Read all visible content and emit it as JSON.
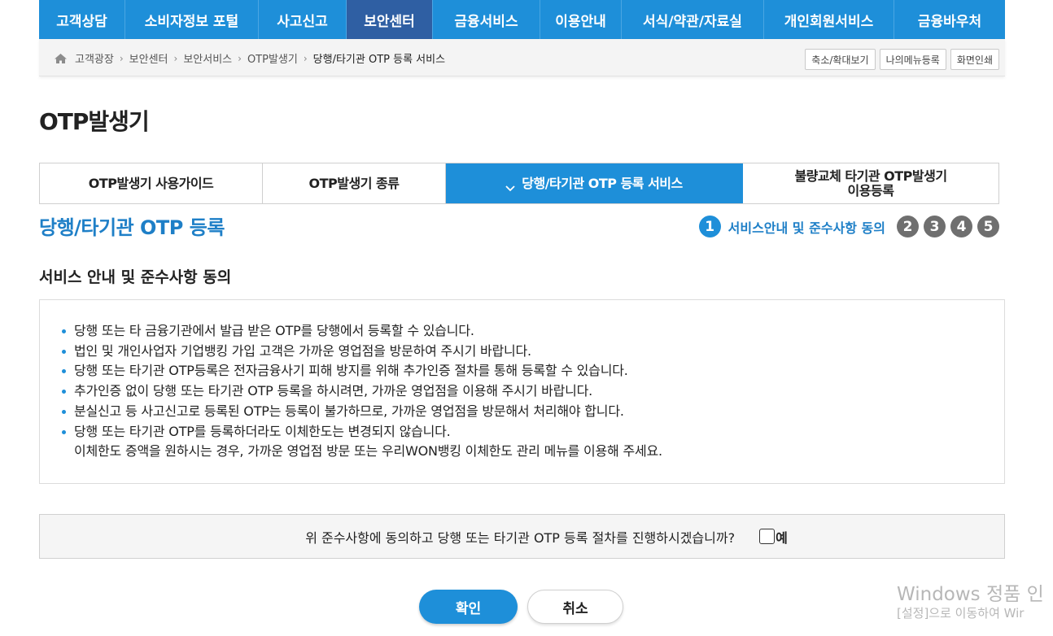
{
  "gnb": [
    {
      "label": "고객상담"
    },
    {
      "label": "소비자정보 포털"
    },
    {
      "label": "사고신고"
    },
    {
      "label": "보안센터",
      "active": true
    },
    {
      "label": "금융서비스"
    },
    {
      "label": "이용안내"
    },
    {
      "label": "서식/약관/자료실"
    },
    {
      "label": "개인회원서비스"
    },
    {
      "label": "금융바우처"
    }
  ],
  "breadcrumb": {
    "items": [
      "고객광장",
      "보안센터",
      "보안서비스",
      "OTP발생기",
      "당행/타기관 OTP 등록 서비스"
    ],
    "buttons": [
      "축소/확대보기",
      "나의메뉴등록",
      "화면인쇄"
    ]
  },
  "page_title": "OTP발생기",
  "tabs": [
    {
      "label": "OTP발생기 사용가이드"
    },
    {
      "label": "OTP발생기 종류"
    },
    {
      "label": "당행/타기관 OTP 등록 서비스",
      "active": true
    },
    {
      "label_line1": "불량교체 타기관 OTP발생기",
      "label_line2": "이용등록"
    }
  ],
  "section": {
    "title": "당행/타기관 OTP 등록",
    "current_step": "1",
    "current_step_label": "서비스안내 및 준수사항 동의",
    "other_steps": [
      "2",
      "3",
      "4",
      "5"
    ]
  },
  "sub_heading": "서비스 안내 및 준수사항 동의",
  "notice": [
    "당행 또는 타 금융기관에서 발급 받은 OTP를 당행에서 등록할 수 있습니다.",
    "법인 및 개인사업자 기업뱅킹 가입 고객은 가까운 영업점을 방문하여 주시기 바랍니다.",
    "당행 또는 타기관 OTP등록은 전자금융사기 피해 방지를 위해 추가인증 절차를 통해 등록할 수 있습니다.",
    "추가인증 없이 당행 또는 타기관 OTP 등록을 하시려면, 가까운 영업점을 이용해 주시기 바랍니다.",
    "분실신고 등 사고신고로 등록된 OTP는 등록이 불가하므로, 가까운 영업점을 방문해서 처리해야 합니다.",
    "당행 또는 타기관 OTP를 등록하더라도 이체한도는 변경되지 않습니다."
  ],
  "notice_continuation": "이체한도 증액을 원하시는 경우, 가까운 영업점 방문 또는 우리WON뱅킹 이체한도 관리 메뉴를 이용해 주세요.",
  "agree": {
    "question": "위 준수사항에 동의하고 당행 또는 타기관 OTP 등록 절차를 진행하시겠습니까?",
    "checkbox_label": "예",
    "checked": false
  },
  "buttons": {
    "confirm": "확인",
    "cancel": "취소"
  },
  "watermark": {
    "line1": "Windows 정품 인",
    "line2": "[설정]으로 이동하여 Wir"
  },
  "colors": {
    "primary": "#1e8fd9",
    "nav_active": "#2f5fa3",
    "step_inactive": "#6f6f6f"
  }
}
